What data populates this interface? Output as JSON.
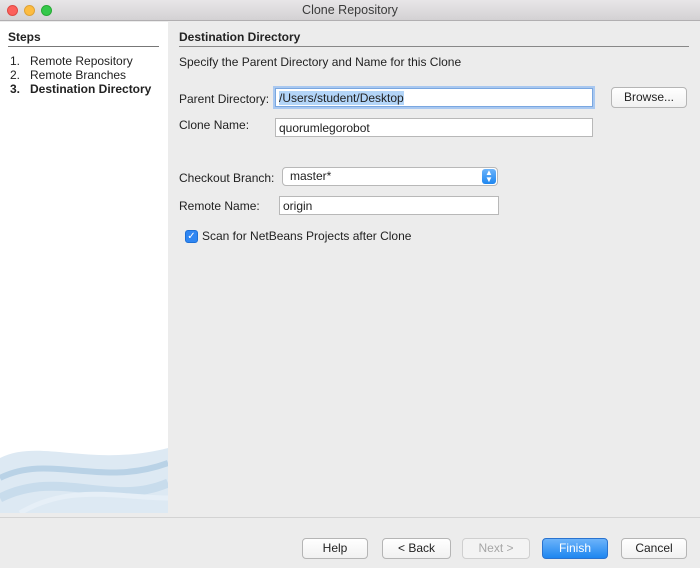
{
  "window": {
    "title": "Clone Repository"
  },
  "steps": {
    "heading": "Steps",
    "items": [
      {
        "num": "1.",
        "label": "Remote Repository"
      },
      {
        "num": "2.",
        "label": "Remote Branches"
      },
      {
        "num": "3.",
        "label": "Destination Directory"
      }
    ]
  },
  "main": {
    "heading": "Destination Directory",
    "description": "Specify the Parent Directory and Name for this Clone",
    "parent_dir_label": "Parent Directory:",
    "parent_dir_value": "/Users/student/Desktop",
    "browse_label": "Browse...",
    "clone_name_label": "Clone Name:",
    "clone_name_value": "quorumlegorobot",
    "checkout_branch_label": "Checkout Branch:",
    "checkout_branch_value": "master*",
    "remote_name_label": "Remote Name:",
    "remote_name_value": "origin",
    "scan_label": "Scan for NetBeans Projects after Clone",
    "scan_checked": true
  },
  "buttons": {
    "help": "Help",
    "back": "< Back",
    "next": "Next >",
    "finish": "Finish",
    "cancel": "Cancel"
  },
  "colors": {
    "accent": "#1e86f0",
    "selection": "#b3d5f8"
  }
}
